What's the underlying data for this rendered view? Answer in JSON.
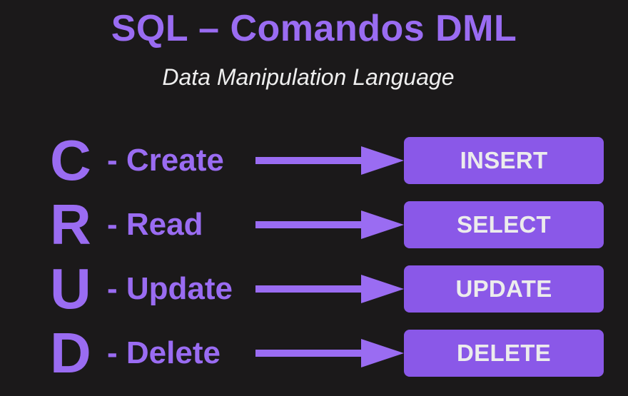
{
  "title": "SQL – Comandos DML",
  "subtitle": "Data Manipulation Language",
  "colors": {
    "background": "#1b191a",
    "accent": "#9a6cf2",
    "box": "#8a58e8",
    "text": "#eeeeee"
  },
  "rows": [
    {
      "letter": "C",
      "word": "- Create",
      "command": "INSERT"
    },
    {
      "letter": "R",
      "word": "- Read",
      "command": "SELECT"
    },
    {
      "letter": "U",
      "word": "- Update",
      "command": "UPDATE"
    },
    {
      "letter": "D",
      "word": "- Delete",
      "command": "DELETE"
    }
  ]
}
